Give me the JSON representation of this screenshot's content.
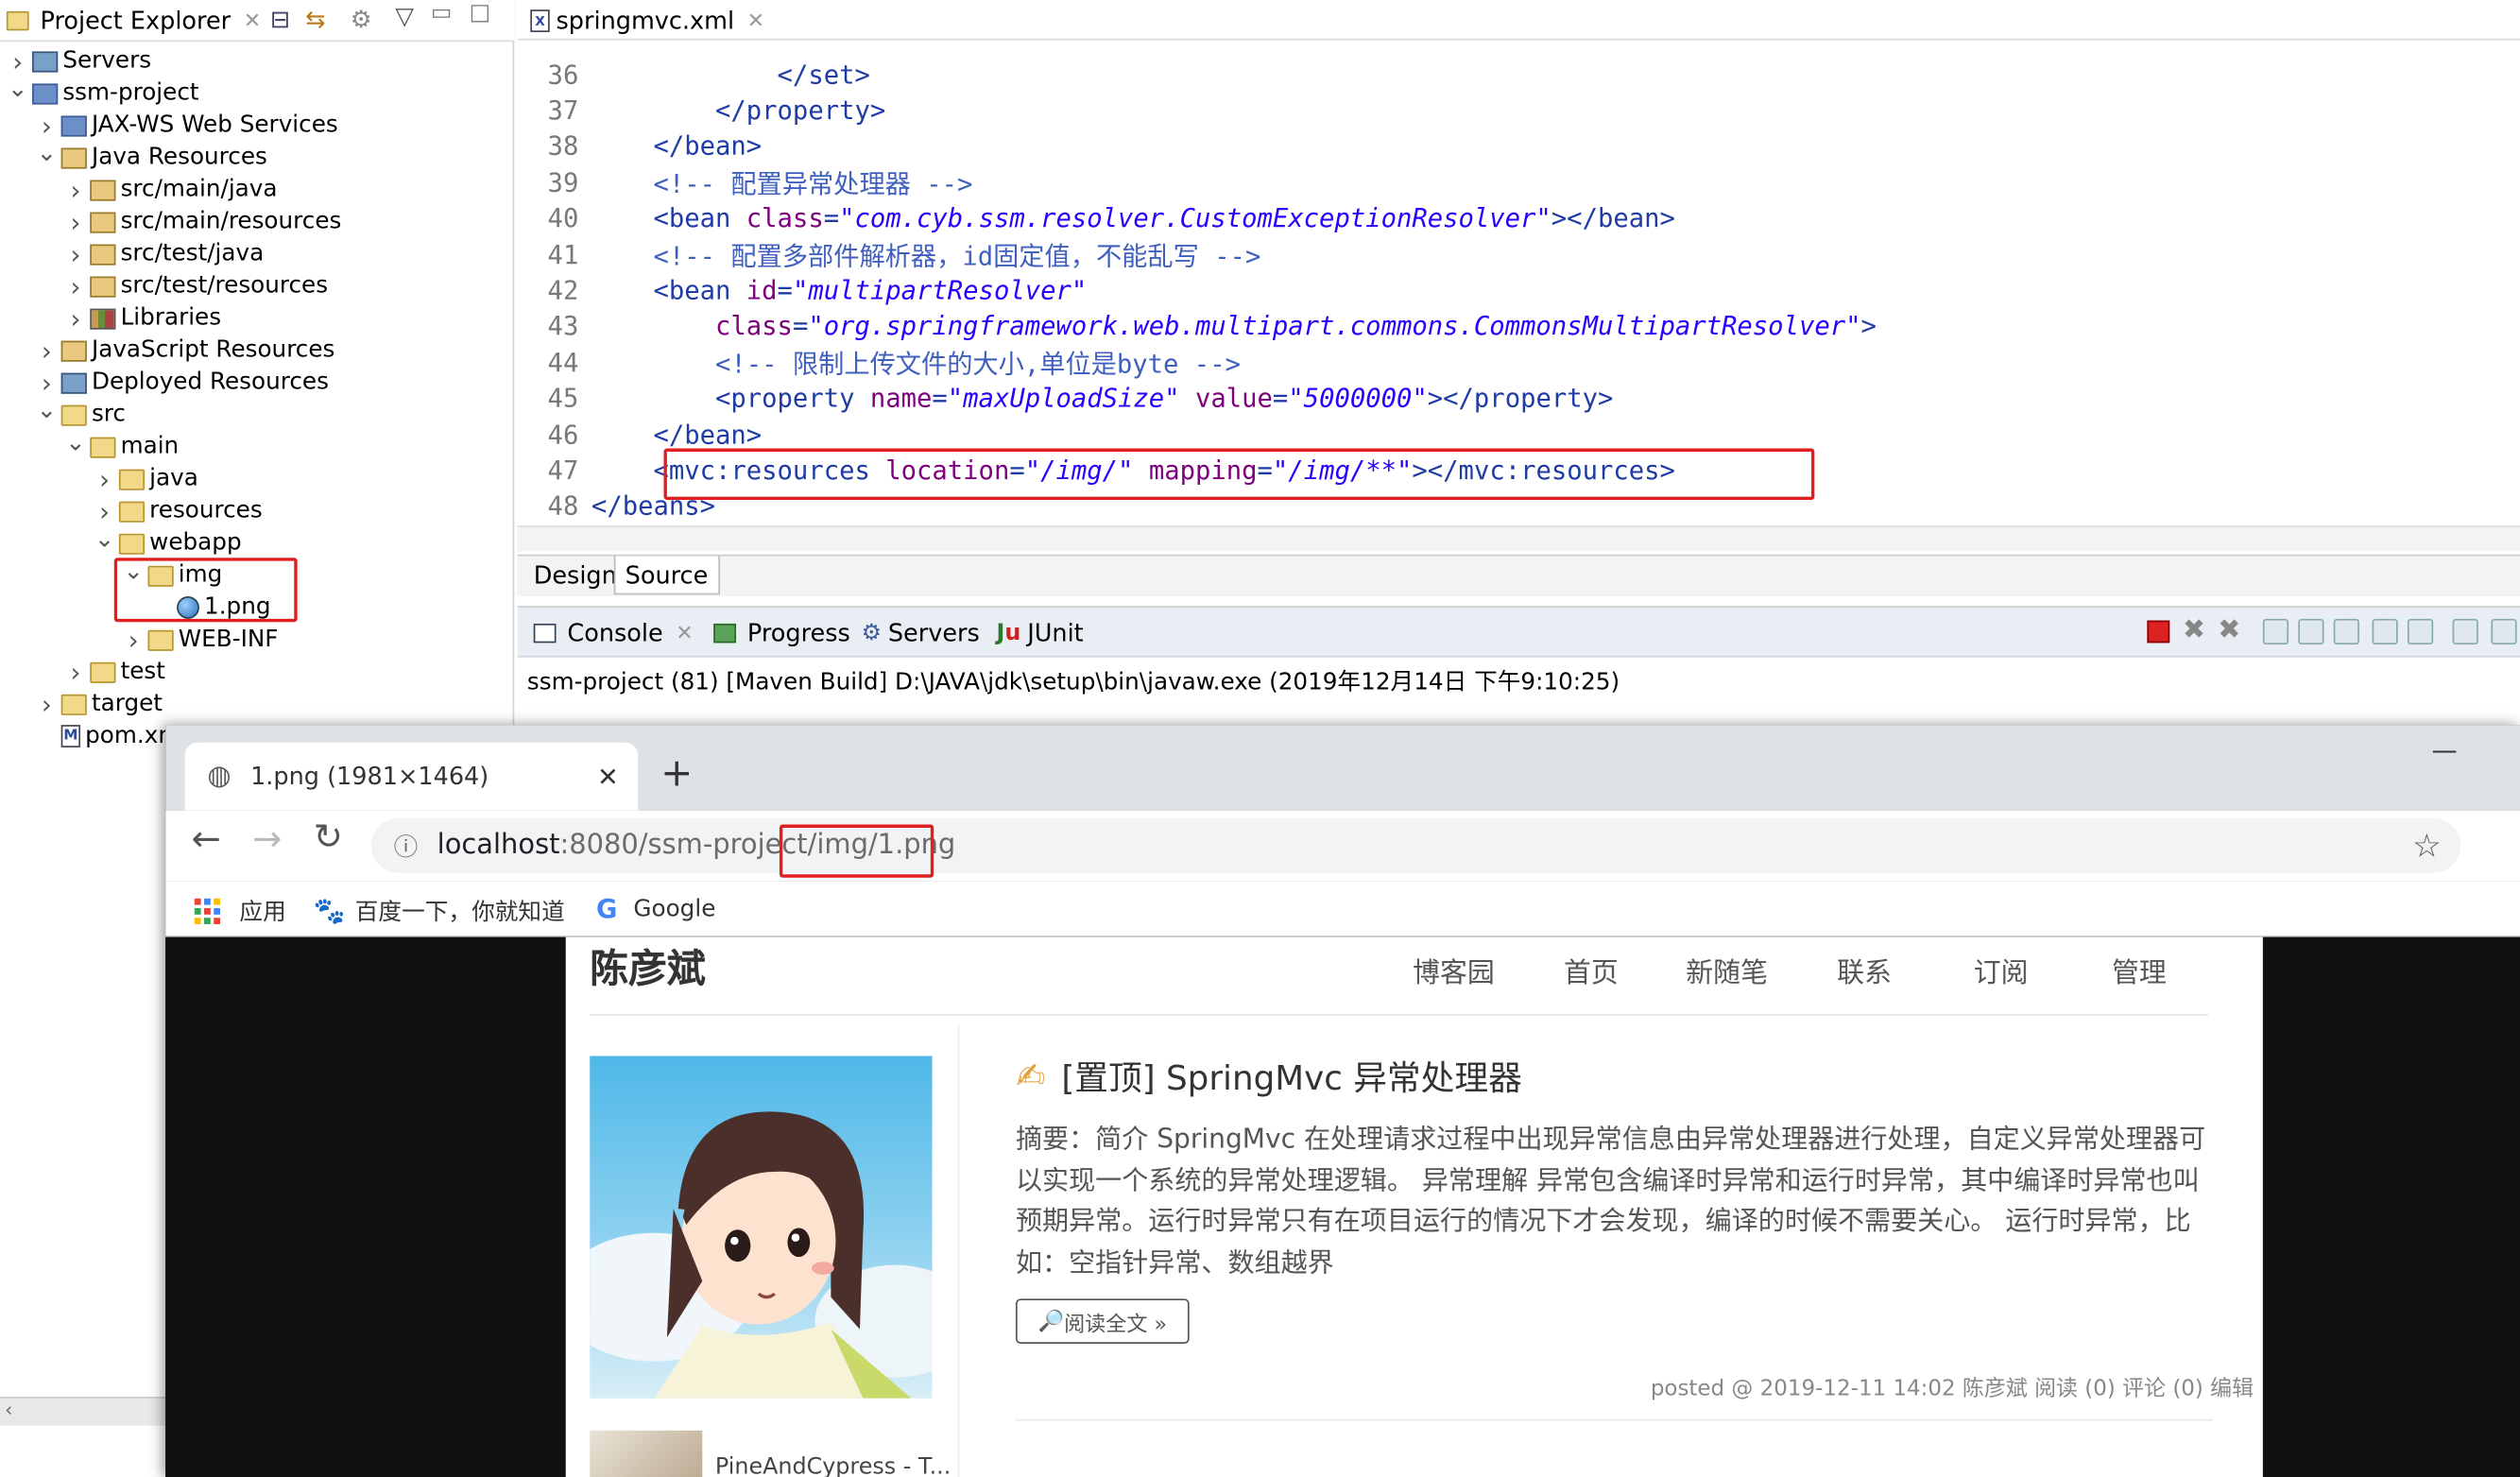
{
  "explorer": {
    "tab_title": "Project Explorer",
    "tree": [
      {
        "label": "Servers",
        "indent": 0,
        "arrow": ">",
        "icon": "server-folder-icon"
      },
      {
        "label": "ssm-project",
        "indent": 0,
        "arrow": "v",
        "icon": "maven-project-icon"
      },
      {
        "label": "JAX-WS Web Services",
        "indent": 1,
        "arrow": ">",
        "icon": "web-services-icon"
      },
      {
        "label": "Java Resources",
        "indent": 1,
        "arrow": "v",
        "icon": "java-resources-icon"
      },
      {
        "label": "src/main/java",
        "indent": 2,
        "arrow": ">",
        "icon": "source-folder-icon"
      },
      {
        "label": "src/main/resources",
        "indent": 2,
        "arrow": ">",
        "icon": "source-folder-icon"
      },
      {
        "label": "src/test/java",
        "indent": 2,
        "arrow": ">",
        "icon": "source-folder-icon"
      },
      {
        "label": "src/test/resources",
        "indent": 2,
        "arrow": ">",
        "icon": "source-folder-icon"
      },
      {
        "label": "Libraries",
        "indent": 2,
        "arrow": ">",
        "icon": "libraries-icon"
      },
      {
        "label": "JavaScript Resources",
        "indent": 1,
        "arrow": ">",
        "icon": "js-resources-icon"
      },
      {
        "label": "Deployed Resources",
        "indent": 1,
        "arrow": ">",
        "icon": "deployed-resources-icon"
      },
      {
        "label": "src",
        "indent": 1,
        "arrow": "v",
        "icon": "folder-icon"
      },
      {
        "label": "main",
        "indent": 2,
        "arrow": "v",
        "icon": "folder-icon"
      },
      {
        "label": "java",
        "indent": 3,
        "arrow": ">",
        "icon": "folder-icon"
      },
      {
        "label": "resources",
        "indent": 3,
        "arrow": ">",
        "icon": "folder-icon"
      },
      {
        "label": "webapp",
        "indent": 3,
        "arrow": "v",
        "icon": "folder-icon"
      },
      {
        "label": "img",
        "indent": 4,
        "arrow": "v",
        "icon": "folder-icon"
      },
      {
        "label": "1.png",
        "indent": 5,
        "arrow": "",
        "icon": "image-file-icon"
      },
      {
        "label": "WEB-INF",
        "indent": 4,
        "arrow": ">",
        "icon": "folder-icon"
      },
      {
        "label": "test",
        "indent": 2,
        "arrow": ">",
        "icon": "folder-icon"
      },
      {
        "label": "target",
        "indent": 1,
        "arrow": ">",
        "icon": "folder-icon"
      },
      {
        "label": "pom.xml",
        "indent": 1,
        "arrow": "",
        "icon": "maven-file-icon"
      }
    ]
  },
  "editor": {
    "tab_title": "springmvc.xml",
    "bottom_tabs": [
      "Design",
      "Source"
    ],
    "lines": [
      {
        "n": "36",
        "parts": [
          [
            "t",
            "            </set>"
          ]
        ]
      },
      {
        "n": "37",
        "parts": [
          [
            "t",
            "        </property>"
          ]
        ]
      },
      {
        "n": "38",
        "parts": [
          [
            "t",
            "    </bean>"
          ]
        ]
      },
      {
        "n": "39",
        "parts": [
          [
            "c",
            "    <!-- 配置异常处理器 -->"
          ]
        ]
      },
      {
        "n": "40",
        "parts": [
          [
            "t",
            "    <bean "
          ],
          [
            "a",
            "class"
          ],
          [
            "t",
            "="
          ],
          [
            "v",
            "\"com.cyb.ssm.resolver.CustomExceptionResolver\""
          ],
          [
            "t",
            "></bean>"
          ]
        ]
      },
      {
        "n": "41",
        "parts": [
          [
            "c",
            "    <!-- 配置多部件解析器，id固定值，不能乱写 -->"
          ]
        ]
      },
      {
        "n": "42",
        "parts": [
          [
            "t",
            "    <bean "
          ],
          [
            "a",
            "id"
          ],
          [
            "t",
            "="
          ],
          [
            "v",
            "\"multipartResolver\""
          ]
        ]
      },
      {
        "n": "43",
        "parts": [
          [
            "a",
            "        class"
          ],
          [
            "t",
            "="
          ],
          [
            "v",
            "\"org.springframework.web.multipart.commons.CommonsMultipartResolver\""
          ],
          [
            "t",
            ">"
          ]
        ]
      },
      {
        "n": "44",
        "parts": [
          [
            "c",
            "        <!-- 限制上传文件的大小,单位是byte -->"
          ]
        ]
      },
      {
        "n": "45",
        "parts": [
          [
            "t",
            "        <property "
          ],
          [
            "a",
            "name"
          ],
          [
            "t",
            "="
          ],
          [
            "v",
            "\"maxUploadSize\""
          ],
          [
            "t",
            " "
          ],
          [
            "a",
            "value"
          ],
          [
            "t",
            "="
          ],
          [
            "v",
            "\"5000000\""
          ],
          [
            "t",
            "></property>"
          ]
        ]
      },
      {
        "n": "46",
        "parts": [
          [
            "t",
            "    </bean>"
          ]
        ]
      },
      {
        "n": "47",
        "parts": [
          [
            "t",
            "    <mvc:resources "
          ],
          [
            "a",
            "location"
          ],
          [
            "t",
            "="
          ],
          [
            "v",
            "\"/img/\""
          ],
          [
            "t",
            " "
          ],
          [
            "a",
            "mapping"
          ],
          [
            "t",
            "="
          ],
          [
            "v",
            "\"/img/**\""
          ],
          [
            "t",
            "></mvc:resources>"
          ]
        ]
      },
      {
        "n": "48",
        "parts": [
          [
            "t",
            "</beans>"
          ]
        ]
      }
    ]
  },
  "console": {
    "tabs": [
      "Console",
      "Progress",
      "Servers",
      "JUnit"
    ],
    "launch_line": "ssm-project (81) [Maven Build] D:\\JAVA\\jdk\\setup\\bin\\javaw.exe (2019年12月14日 下午9:10:25)"
  },
  "browser": {
    "tab_title": "1.png (1981×1464)",
    "url_host": "localhost",
    "url_rest": ":8080/ssm-project/img/1.png",
    "bookmarks": [
      "应用",
      "百度一下，你就知道",
      "Google"
    ],
    "page": {
      "site_title": "陈彦斌",
      "nav": [
        "博客园",
        "首页",
        "新随笔",
        "联系",
        "订阅",
        "管理"
      ],
      "post_title": "[置顶] SpringMvc 异常处理器",
      "summary": "摘要：简介 SpringMvc 在处理请求过程中出现异常信息由异常处理器进行处理，自定义异常处理器可以实现一个系统的异常处理逻辑。 异常理解 异常包含编译时异常和运行时异常，其中编译时异常也叫预期异常。运行时异常只有在项目运行的情况下才会发现，编译的时候不需要关心。 运行时异常，比如：空指针异常、数组越界",
      "read_more": "阅读全文 »",
      "meta": "posted @ 2019-12-11 14:02 陈彦斌 阅读 (0) 评论 (0) 编辑",
      "sidebar_link": "PineAndCypress - T..."
    }
  },
  "colors": {
    "highlight": "#e02020",
    "tag": "#1f3ca6",
    "attr": "#7f007f",
    "value": "#2a00ff",
    "comment": "#3f5fbf"
  }
}
